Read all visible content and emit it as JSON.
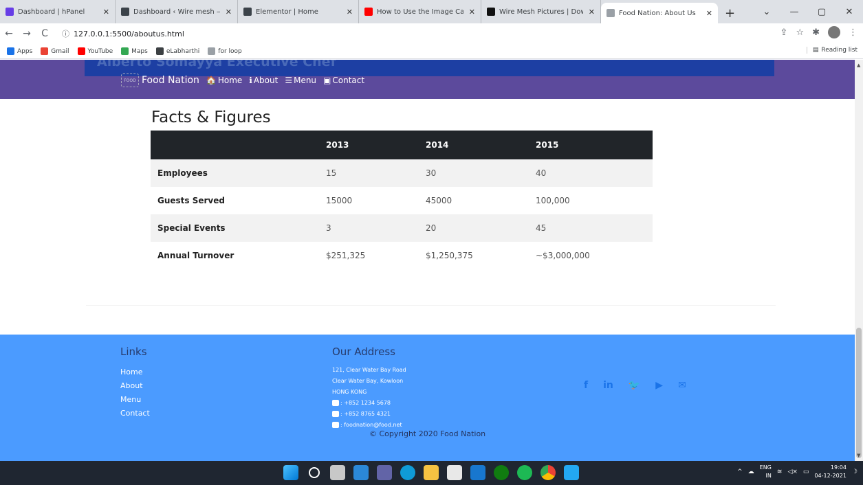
{
  "browser": {
    "tabs": [
      {
        "title": "Dashboard | hPanel",
        "favicon": "hpanel-icon",
        "color": "#673de6"
      },
      {
        "title": "Dashboard ‹ Wire mesh —",
        "favicon": "wordpress-icon",
        "color": "#3c434a"
      },
      {
        "title": "Elementor | Home",
        "favicon": "wordpress-icon",
        "color": "#3c434a"
      },
      {
        "title": "How to Use the Image Caro",
        "favicon": "youtube-icon",
        "color": "#ff0000"
      },
      {
        "title": "Wire Mesh Pictures | Downl",
        "favicon": "unsplash-icon",
        "color": "#111111"
      },
      {
        "title": "Food Nation: About Us",
        "favicon": "food-nation-icon",
        "color": "#9aa0a6"
      }
    ],
    "url": "127.0.0.1:5500/aboutus.html",
    "bookmarks": [
      {
        "label": "Apps",
        "icon": "apps-grid-icon",
        "color": "#1a73e8"
      },
      {
        "label": "Gmail",
        "icon": "gmail-icon",
        "color": "#ea4335"
      },
      {
        "label": "YouTube",
        "icon": "youtube-icon",
        "color": "#ff0000"
      },
      {
        "label": "Maps",
        "icon": "maps-icon",
        "color": "#34a853"
      },
      {
        "label": "eLabharthi",
        "icon": "globe-icon",
        "color": "#3c4043"
      },
      {
        "label": "for loop",
        "icon": "w3-icon",
        "color": "#9aa0a6"
      }
    ],
    "reading_list": "Reading list"
  },
  "site": {
    "banner_partial": "Alberto Somayya Executive Chef",
    "brand": "Food Nation",
    "nav": [
      {
        "label": "Home",
        "icon": "home-icon",
        "glyph": "🏠"
      },
      {
        "label": "About",
        "icon": "info-icon",
        "glyph": "ℹ"
      },
      {
        "label": "Menu",
        "icon": "list-icon",
        "glyph": "☰"
      },
      {
        "label": "Contact",
        "icon": "address-card-icon",
        "glyph": "▣"
      }
    ],
    "facts": {
      "heading": "Facts & Figures",
      "columns": [
        "",
        "2013",
        "2014",
        "2015"
      ],
      "rows": [
        [
          "Employees",
          "15",
          "30",
          "40"
        ],
        [
          "Guests Served",
          "15000",
          "45000",
          "100,000"
        ],
        [
          "Special Events",
          "3",
          "20",
          "45"
        ],
        [
          "Annual Turnover",
          "$251,325",
          "$1,250,375",
          "~$3,000,000"
        ]
      ]
    },
    "footer": {
      "links_heading": "Links",
      "links": [
        "Home",
        "About",
        "Menu",
        "Contact"
      ],
      "address_heading": "Our Address",
      "address_lines": [
        "121, Clear Water Bay Road",
        "Clear Water Bay, Kowloon",
        "HONG KONG"
      ],
      "phone": ": +852 1234 5678",
      "fax": ": +852 8765 4321",
      "email": ": foodnation@food.net",
      "copyright": "© Copyright 2020 Food Nation",
      "social": [
        {
          "icon": "facebook-icon",
          "glyph": "f"
        },
        {
          "icon": "linkedin-icon",
          "glyph": "in"
        },
        {
          "icon": "twitter-icon",
          "glyph": "🐦"
        },
        {
          "icon": "youtube-icon",
          "glyph": "▶"
        },
        {
          "icon": "mail-icon",
          "glyph": "✉"
        }
      ]
    }
  },
  "taskbar": {
    "lang": "ENG",
    "lang2": "IN",
    "time": "19:04",
    "date": "04-12-2021"
  }
}
